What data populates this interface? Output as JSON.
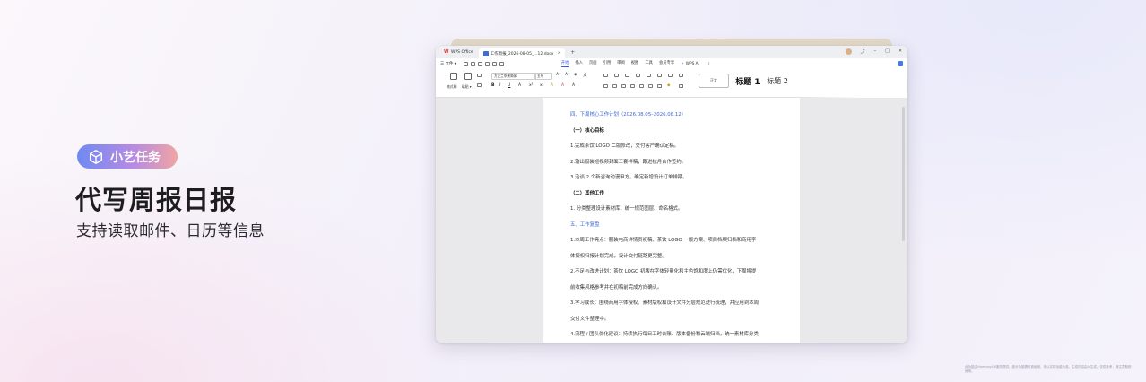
{
  "marketing": {
    "badge": "小艺任务",
    "title": "代写周报日报",
    "subtitle": "支持读取邮件、日历等信息",
    "disclaimer": "此功能由HarmonyOS服务提供，部分功能需付费使用，请以实际功能为准。生成内容由AI生成，仅供参考，请注意甄别使用。"
  },
  "window": {
    "app_tab": "WPS Office",
    "doc_tab": "工作周报_2026-08-05_...12.docx",
    "menu_file": "三 文件 ▾",
    "tabs": [
      "开始",
      "插入",
      "页面",
      "引用",
      "审阅",
      "视图",
      "工具",
      "会员专享"
    ],
    "wps_ai": "WPS AI",
    "ribbon": {
      "format_painter": "格式刷",
      "paste": "粘贴 ▾",
      "font_name": "方正兰亭黑简体",
      "font_size": "五号",
      "style_normal": "正文",
      "style_h1": "标题 1",
      "style_h2": "标题 2"
    }
  },
  "document": {
    "lines": [
      {
        "text": "四、下周核心工作计划（2026.08.05–2026.08.12）",
        "style": "h-blue"
      },
      {
        "text": "（一）核心目标",
        "style": "h-bold"
      },
      {
        "text": "1.完成茶饮 LOGO 二版修改，交付客户确认定稿。",
        "style": ""
      },
      {
        "text": "2.输出服装短视频封面三套样稿，跟进杭月合作签约。",
        "style": ""
      },
      {
        "text": "3.洽谈 2 个新咨询动漫甲方，确定新增设计订单排期。",
        "style": ""
      },
      {
        "text": "（二）其他工作",
        "style": "h-bold"
      },
      {
        "text": "1.  分类整理设计素材库，统一规范图层、命名格式。",
        "style": ""
      },
      {
        "text": "五、工作复盘",
        "style": "h-blue"
      },
      {
        "text": "1.本周工作亮点：服装电商详情页初稿、茶饮 LOGO 一版方案、项目档案归档和商用字",
        "style": ""
      },
      {
        "text": "体授权归报计划完成，设计交付链路更完整。",
        "style": ""
      },
      {
        "text": "2.不足与改进计划：茶饮 LOGO 初版在字体轻量化和主色饱和度上仍需优化，下周将提",
        "style": ""
      },
      {
        "text": "前收集风格参考并在初稿前完成方向确认。",
        "style": ""
      },
      {
        "text": "3.学习成长：围绕商用字体授权、素材版权和设计文件分层规范进行梳理，并应用到本周",
        "style": ""
      },
      {
        "text": "交付文件整理中。",
        "style": ""
      },
      {
        "text": "4.流程 / 团队优化建议：持续执行每日工时台账、版本备份和云端归档，统一素材库分类",
        "style": ""
      }
    ]
  }
}
